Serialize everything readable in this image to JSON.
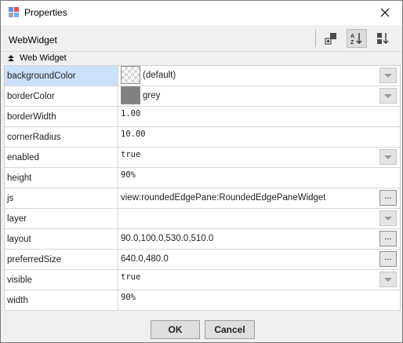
{
  "window": {
    "title": "Properties",
    "close_icon": "close-icon"
  },
  "toolbar": {
    "title": "WebWidget",
    "buttons": [
      {
        "icon": "add-slot-icon"
      },
      {
        "icon": "sort-az-icon",
        "active": true
      },
      {
        "icon": "sort-order-icon"
      }
    ]
  },
  "section": {
    "label": "Web Widget",
    "icon": "collapse-up-icon"
  },
  "properties": [
    {
      "name": "backgroundColor",
      "value": "(default)",
      "swatch": "checker",
      "control": "dropdown",
      "selected": true
    },
    {
      "name": "borderColor",
      "value": "grey",
      "swatch": "grey",
      "control": "dropdown"
    },
    {
      "name": "borderWidth",
      "value": "1.00",
      "mono": true
    },
    {
      "name": "cornerRadius",
      "value": "10.00",
      "mono": true
    },
    {
      "name": "enabled",
      "value": "true",
      "mono": true,
      "control": "dropdown"
    },
    {
      "name": "height",
      "value": "90%",
      "mono": true
    },
    {
      "name": "js",
      "value": "view:roundedEdgePane:RoundedEdgePaneWidget",
      "control": "ellipsis"
    },
    {
      "name": "layer",
      "value": "",
      "control": "dropdown"
    },
    {
      "name": "layout",
      "value": "90.0,100.0,530.0,510.0",
      "control": "ellipsis"
    },
    {
      "name": "preferredSize",
      "value": "640.0,480.0",
      "control": "ellipsis"
    },
    {
      "name": "visible",
      "value": "true",
      "mono": true,
      "control": "dropdown"
    },
    {
      "name": "width",
      "value": "90%",
      "mono": true
    }
  ],
  "ellipsis_label": "...",
  "footer": {
    "ok_label": "OK",
    "cancel_label": "Cancel"
  }
}
